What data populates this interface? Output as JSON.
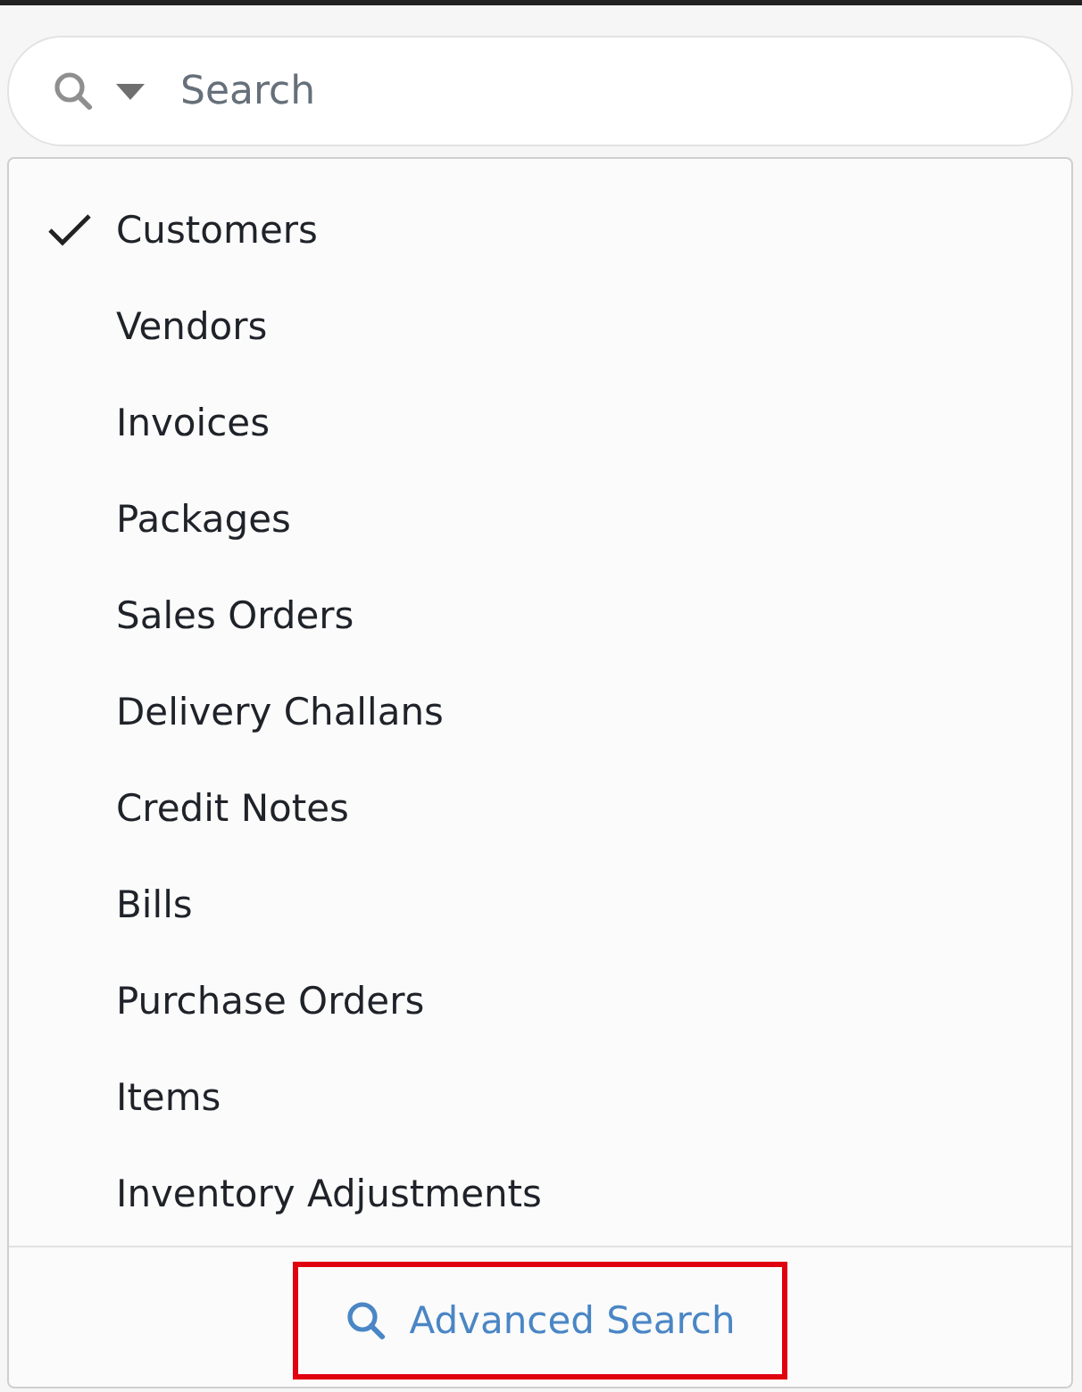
{
  "search": {
    "placeholder": "Search"
  },
  "menu": {
    "items": [
      {
        "label": "Customers",
        "selected": true
      },
      {
        "label": "Vendors",
        "selected": false
      },
      {
        "label": "Invoices",
        "selected": false
      },
      {
        "label": "Packages",
        "selected": false
      },
      {
        "label": "Sales Orders",
        "selected": false
      },
      {
        "label": "Delivery Challans",
        "selected": false
      },
      {
        "label": "Credit Notes",
        "selected": false
      },
      {
        "label": "Bills",
        "selected": false
      },
      {
        "label": "Purchase Orders",
        "selected": false
      },
      {
        "label": "Items",
        "selected": false
      },
      {
        "label": "Inventory Adjustments",
        "selected": false
      }
    ],
    "footer": {
      "label": "Advanced Search",
      "highlighted": true
    }
  }
}
